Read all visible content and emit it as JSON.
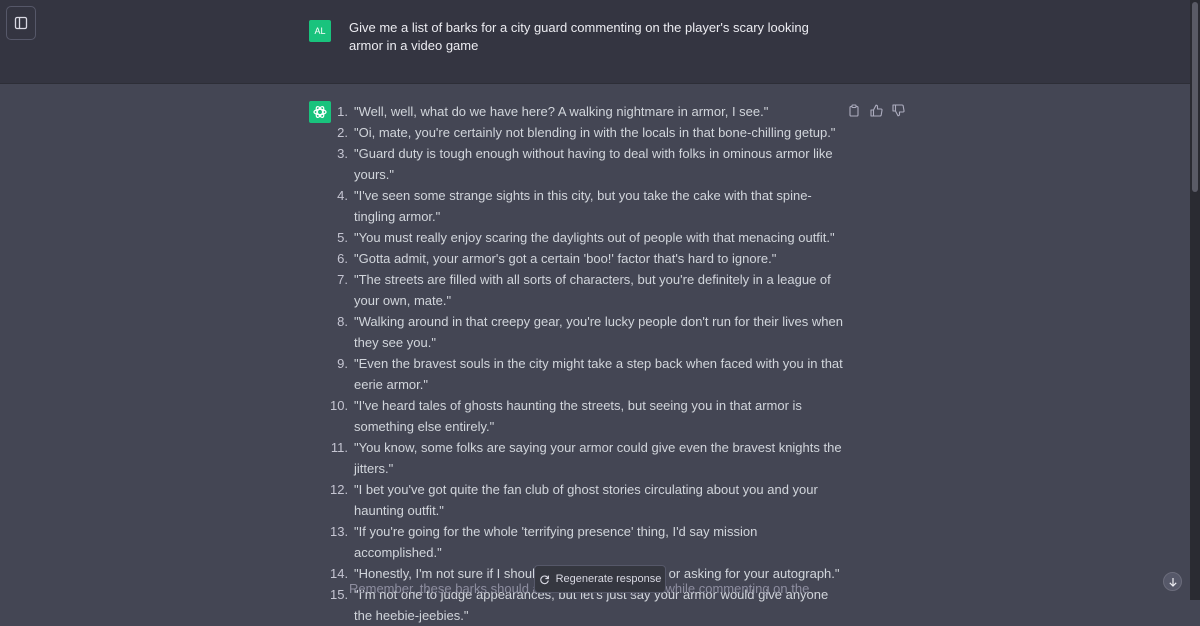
{
  "user": {
    "avatar_initials": "AL",
    "message": "Give me a list of barks for a city guard commenting on the player's scary looking armor in a video game"
  },
  "assistant": {
    "items": [
      {
        "num": "1.",
        "text": "\"Well, well, what do we have here? A walking nightmare in armor, I see.\""
      },
      {
        "num": "2.",
        "text": "\"Oi, mate, you're certainly not blending in with the locals in that bone-chilling getup.\""
      },
      {
        "num": "3.",
        "text": "\"Guard duty is tough enough without having to deal with folks in ominous armor like yours.\""
      },
      {
        "num": "4.",
        "text": "\"I've seen some strange sights in this city, but you take the cake with that spine-tingling armor.\""
      },
      {
        "num": "5.",
        "text": "\"You must really enjoy scaring the daylights out of people with that menacing outfit.\""
      },
      {
        "num": "6.",
        "text": "\"Gotta admit, your armor's got a certain 'boo!' factor that's hard to ignore.\""
      },
      {
        "num": "7.",
        "text": "\"The streets are filled with all sorts of characters, but you're definitely in a league of your own, mate.\""
      },
      {
        "num": "8.",
        "text": "\"Walking around in that creepy gear, you're lucky people don't run for their lives when they see you.\""
      },
      {
        "num": "9.",
        "text": "\"Even the bravest souls in the city might take a step back when faced with you in that eerie armor.\""
      },
      {
        "num": "10.",
        "text": "\"I've heard tales of ghosts haunting the streets, but seeing you in that armor is something else entirely.\""
      },
      {
        "num": "11.",
        "text": "\"You know, some folks are saying your armor could give even the bravest knights the jitters.\""
      },
      {
        "num": "12.",
        "text": "\"I bet you've got quite the fan club of ghost stories circulating about you and your haunting outfit.\""
      },
      {
        "num": "13.",
        "text": "\"If you're going for the whole 'terrifying presence' thing, I'd say mission accomplished.\""
      },
      {
        "num": "14.",
        "text": "\"Honestly, I'm not sure if I should be calling for backup or asking for your autograph.\""
      },
      {
        "num": "15.",
        "text": "\"I'm not one to judge appearances, but let's just say your armor would give anyone the heebie-jeebies.\""
      }
    ],
    "closing_visible": "Remember, these barks should add flavor to the game while commenting on the"
  },
  "regenerate_label": "Regenerate response",
  "icons": {
    "sidebar": "sidebar-toggle-icon",
    "assistant": "openai-logo-icon",
    "copy": "clipboard-icon",
    "like": "thumbs-up-icon",
    "dislike": "thumbs-down-icon",
    "regenerate": "refresh-icon",
    "scroll": "arrow-down-icon"
  },
  "colors": {
    "accent": "#19c37d",
    "user_bg": "#343541",
    "assistant_bg": "#444654"
  }
}
